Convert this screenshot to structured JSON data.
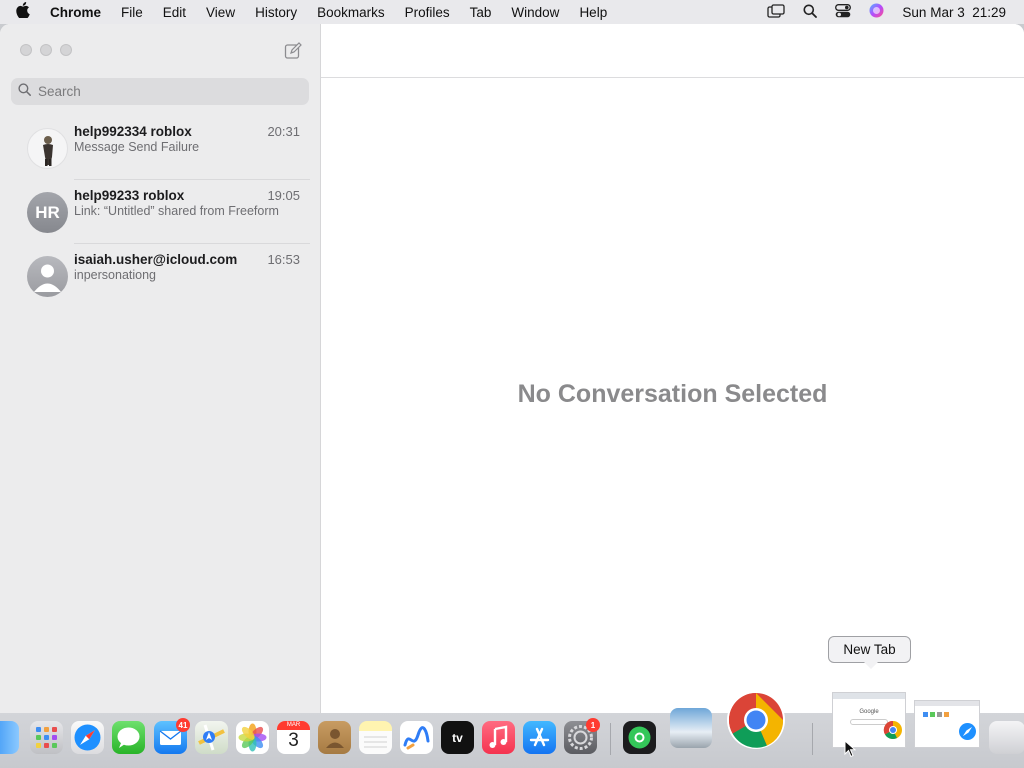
{
  "menubar": {
    "app": "Chrome",
    "items": [
      "File",
      "Edit",
      "View",
      "History",
      "Bookmarks",
      "Profiles",
      "Tab",
      "Window",
      "Help"
    ],
    "datetime": "Sun Mar 3  21:29"
  },
  "sidebar": {
    "search_placeholder": "Search",
    "conversations": [
      {
        "name": "help992334 roblox",
        "time": "20:31",
        "preview": "Message Send Failure",
        "avatar": "photo"
      },
      {
        "name": "help99233 roblox",
        "time": "19:05",
        "preview": "Link: “Untitled” shared from Freeform",
        "avatar": "initials",
        "initials": "HR"
      },
      {
        "name": "isaiah.usher@icloud.com",
        "time": "16:53",
        "preview": "inpersonationg",
        "avatar": "generic"
      }
    ]
  },
  "main": {
    "empty_state": "No Conversation Selected"
  },
  "dock": {
    "tooltip": "New Tab",
    "mail_badge": "41",
    "settings_badge": "1",
    "calendar_month": "MAR",
    "calendar_day": "3",
    "tv_label": "tv",
    "thumb_google_label": "Google",
    "colors": {
      "accent": "#007aff",
      "badge": "#ff3b30"
    }
  }
}
